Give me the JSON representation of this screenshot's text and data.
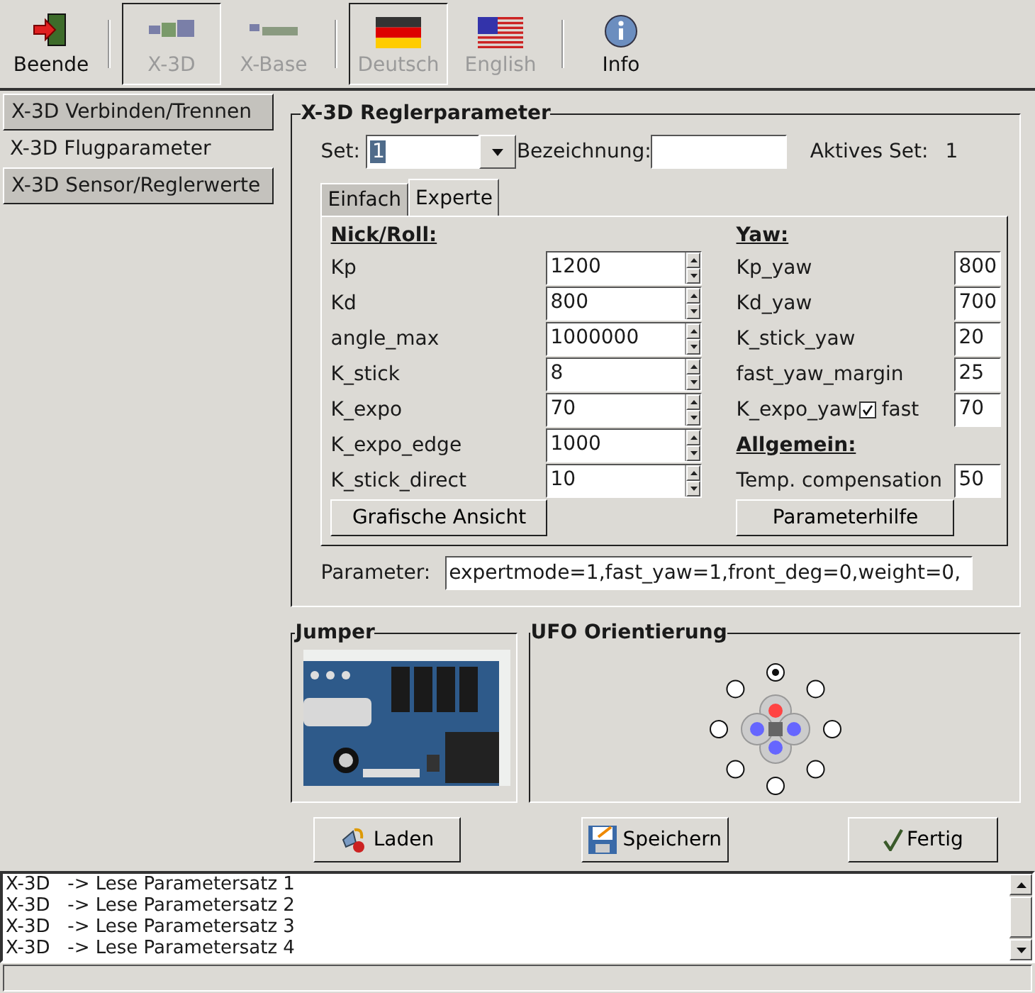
{
  "toolbar": [
    {
      "label": "Beende",
      "kind": "exit",
      "pressed": false,
      "disabled": false
    },
    {
      "kind": "separator"
    },
    {
      "label": "X-3D",
      "kind": "x3d",
      "pressed": true,
      "disabled": true
    },
    {
      "label": "X-Base",
      "kind": "xbase",
      "pressed": false,
      "disabled": true
    },
    {
      "kind": "separator"
    },
    {
      "label": "Deutsch",
      "kind": "flag_de",
      "pressed": true,
      "disabled": true
    },
    {
      "label": "English",
      "kind": "flag_us",
      "pressed": false,
      "disabled": true
    },
    {
      "kind": "separator"
    },
    {
      "label": "Info",
      "kind": "info",
      "pressed": false,
      "disabled": false
    }
  ],
  "sidebar": {
    "items": [
      {
        "label": "X-3D Verbinden/Trennen",
        "selected": false
      },
      {
        "label": "X-3D Flugparameter",
        "selected": true
      },
      {
        "label": "X-3D Sensor/Reglerwerte",
        "selected": false
      }
    ]
  },
  "params_panel": {
    "title": "X-3D Reglerparameter",
    "set_label": "Set:",
    "set_value": "1",
    "name_label": "Bezeichnung:",
    "active_label": "Aktives Set:",
    "active_value": "1",
    "tabs": [
      {
        "label": "Einfach",
        "selected": false
      },
      {
        "label": "Experte",
        "selected": true
      }
    ],
    "nick_roll": {
      "heading": "Nick/Roll:",
      "params": [
        {
          "label": "Kp",
          "value": "1200"
        },
        {
          "label": "Kd",
          "value": "800"
        },
        {
          "label": "angle_max",
          "value": "1000000"
        },
        {
          "label": "K_stick",
          "value": "8"
        },
        {
          "label": "K_expo",
          "value": "70"
        },
        {
          "label": "K_expo_edge",
          "value": "1000"
        },
        {
          "label": "K_stick_direct",
          "value": "10"
        }
      ],
      "button": "Grafische Ansicht"
    },
    "yaw": {
      "heading": "Yaw:",
      "params": [
        {
          "label": "Kp_yaw",
          "value": "800"
        },
        {
          "label": "Kd_yaw",
          "value": "700"
        },
        {
          "label": "K_stick_yaw",
          "value": "20"
        },
        {
          "label": "fast_yaw_margin",
          "value": "25"
        },
        {
          "label": "K_expo_yaw",
          "value": "70",
          "option": {
            "label": "fast",
            "checked": true
          }
        }
      ]
    },
    "general": {
      "heading": "Allgemein:",
      "params": [
        {
          "label": "Temp. compensation",
          "value": "50"
        }
      ],
      "button": "Parameterhilfe"
    },
    "parameter_label": "Parameter:",
    "parameter_value": "expertmode=1,fast_yaw=1,front_deg=0,weight=0,"
  },
  "jumper": {
    "title": "Jumper"
  },
  "orientation": {
    "title": "UFO Orientierung",
    "positions": [
      {
        "selected": true
      },
      {
        "selected": false
      },
      {
        "selected": false
      },
      {
        "selected": false
      },
      {
        "selected": false
      },
      {
        "selected": false
      },
      {
        "selected": false
      },
      {
        "selected": false
      }
    ]
  },
  "buttons": [
    {
      "label": "Laden",
      "kind": "load"
    },
    {
      "label": "Speichern",
      "kind": "save"
    },
    {
      "label": "Fertig",
      "kind": "done"
    }
  ],
  "log": [
    "X-3D   -> Lese Parametersatz 1",
    "X-3D   -> Lese Parametersatz 2",
    "X-3D   -> Lese Parametersatz 3",
    "X-3D   -> Lese Parametersatz 4"
  ]
}
